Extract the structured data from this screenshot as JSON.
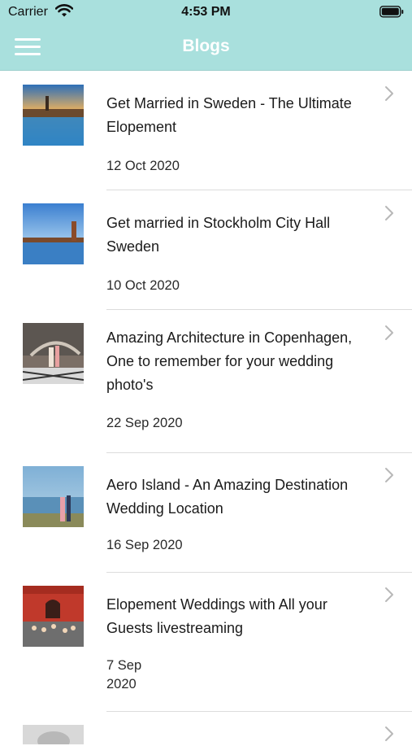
{
  "status_bar": {
    "carrier": "Carrier",
    "time": "4:53 PM"
  },
  "nav": {
    "title": "Blogs",
    "menu_icon": "hamburger-menu-icon",
    "background": "#a9e0dd"
  },
  "blogs": [
    {
      "title": "Get Married in Sweden - The Ultimate Elopement",
      "date": "12 Oct 2020",
      "thumb": "stockholm-sunset-waterfront"
    },
    {
      "title": "Get married in Stockholm City Hall Sweden",
      "date": "10 Oct 2020",
      "thumb": "stockholm-city-hall-waterfront"
    },
    {
      "title": "Amazing Architecture in Copenhagen, One to remember for your wedding photo's",
      "date": "22 Sep 2020",
      "thumb": "couple-spiral-staircase"
    },
    {
      "title": "Aero Island - An Amazing Destination Wedding Location",
      "date": "16 Sep 2020",
      "thumb": "couple-on-beach"
    },
    {
      "title": "Elopement Weddings with All your Guests livestreaming",
      "date_line1": "7 Sep",
      "date_line2": "2020",
      "thumb": "wedding-guests-red-building"
    }
  ]
}
